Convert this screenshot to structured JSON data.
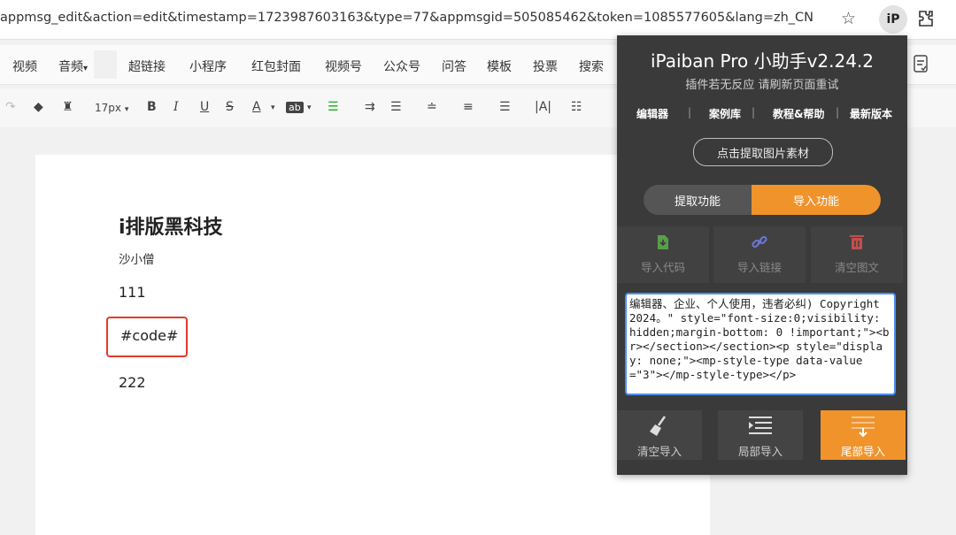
{
  "browser": {
    "url": "appmsg_edit&action=edit&timestamp=1723987603163&type=77&appmsgid=505085462&token=1085577605&lang=zh_CN",
    "extension_badge": "iP"
  },
  "menu": {
    "items": [
      "视频",
      "音频",
      "超链接",
      "小程序",
      "红包封面",
      "视频号",
      "公众号",
      "问答",
      "模板",
      "投票",
      "搜索"
    ],
    "audio_caret": "▾"
  },
  "toolbar": {
    "font_size": "17px",
    "caret": "▾",
    "bold": "B",
    "italic": "I",
    "underline": "U",
    "strike": "S",
    "font_color": "A",
    "bg_color": "ab"
  },
  "document": {
    "title": "i排版黑科技",
    "author": "沙小僧",
    "line1": "111",
    "code_placeholder": "#code#",
    "line2": "222"
  },
  "panel": {
    "title": "iPaiban Pro 小助手v2.24.2",
    "subtitle": "插件若无反应 请刷新页面重试",
    "nav": [
      "编辑器",
      "案例库",
      "教程&帮助",
      "最新版本"
    ],
    "nav_sep": "|",
    "extract_images": "点击提取图片素材",
    "toggle_left": "提取功能",
    "toggle_right": "导入功能",
    "actions": [
      "导入代码",
      "导入链接",
      "清空图文"
    ],
    "code": "编辑器、企业、个人使用，违者必纠) Copyright 2024。\" style=\"font-size:0;visibility: hidden;margin-bottom: 0 !important;\"><br></section></section><p style=\"display: none;\"><mp-style-type data-value=\"3\"></mp-style-type></p>",
    "bottom": [
      "清空导入",
      "局部导入",
      "尾部导入"
    ]
  },
  "colors": {
    "accent": "#f0932b",
    "panel_bg": "#3a3a3a",
    "highlight_red": "#e03a2c",
    "focus_blue": "#4a8ff0"
  }
}
